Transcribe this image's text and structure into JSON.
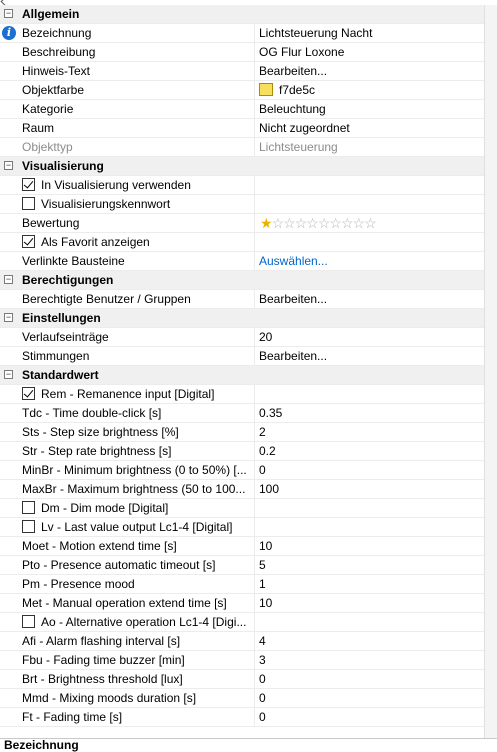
{
  "rating": {
    "filled": 1,
    "total": 10
  },
  "colors": {
    "object_color": "#f7de5c",
    "link": "#0066cc",
    "info_icon": "#1a6fd1"
  },
  "bottom_title": "Bezeichnung",
  "sections": [
    {
      "title": "Allgemein",
      "rows": [
        {
          "label": "Bezeichnung",
          "value": "Lichtsteuerung Nacht",
          "icon": "info-icon"
        },
        {
          "label": "Beschreibung",
          "value": "OG Flur Loxone"
        },
        {
          "label": "Hinweis-Text",
          "value": "Bearbeiten..."
        },
        {
          "label": "Objektfarbe",
          "value": "f7de5c"
        },
        {
          "label": "Kategorie",
          "value": "Beleuchtung"
        },
        {
          "label": "Raum",
          "value": "Nicht zugeordnet"
        },
        {
          "label": "Objekttyp",
          "value": "Lichtsteuerung"
        }
      ]
    },
    {
      "title": "Visualisierung",
      "rows": [
        {
          "label": "In Visualisierung verwenden",
          "checked": true
        },
        {
          "label": "Visualisierungskennwort",
          "checked": false
        },
        {
          "label": "Bewertung"
        },
        {
          "label": "Als Favorit anzeigen",
          "checked": true
        },
        {
          "label": "Verlinkte Bausteine",
          "value": "Auswählen..."
        }
      ]
    },
    {
      "title": "Berechtigungen",
      "rows": [
        {
          "label": "Berechtigte Benutzer / Gruppen",
          "value": "Bearbeiten..."
        }
      ]
    },
    {
      "title": "Einstellungen",
      "rows": [
        {
          "label": "Verlaufseinträge",
          "value": "20"
        },
        {
          "label": "Stimmungen",
          "value": "Bearbeiten..."
        }
      ]
    },
    {
      "title": "Standardwert",
      "rows": [
        {
          "label": "Rem - Remanence input [Digital]",
          "checked": true
        },
        {
          "label": "Tdc - Time double-click [s]",
          "value": "0.35"
        },
        {
          "label": "Sts - Step size brightness [%]",
          "value": "2"
        },
        {
          "label": "Str - Step rate brightness [s]",
          "value": "0.2"
        },
        {
          "label": "MinBr - Minimum brightness (0 to 50%) [...",
          "value": "0"
        },
        {
          "label": "MaxBr - Maximum brightness (50 to 100...",
          "value": "100"
        },
        {
          "label": "Dm - Dim mode [Digital]",
          "checked": false
        },
        {
          "label": "Lv - Last value output Lc1-4 [Digital]",
          "checked": false
        },
        {
          "label": "Moet - Motion extend time [s]",
          "value": "10"
        },
        {
          "label": "Pto - Presence automatic timeout [s]",
          "value": "5"
        },
        {
          "label": "Pm - Presence mood",
          "value": "1"
        },
        {
          "label": "Met - Manual operation extend time [s]",
          "value": "10"
        },
        {
          "label": "Ao - Alternative operation Lc1-4 [Digi...",
          "checked": false
        },
        {
          "label": "Afi - Alarm flashing interval [s]",
          "value": "4"
        },
        {
          "label": "Fbu - Fading time buzzer [min]",
          "value": "3"
        },
        {
          "label": "Brt - Brightness threshold [lux]",
          "value": "0"
        },
        {
          "label": "Mmd - Mixing moods duration [s]",
          "value": "0"
        },
        {
          "label": "Ft - Fading time [s]",
          "value": "0"
        }
      ]
    }
  ]
}
